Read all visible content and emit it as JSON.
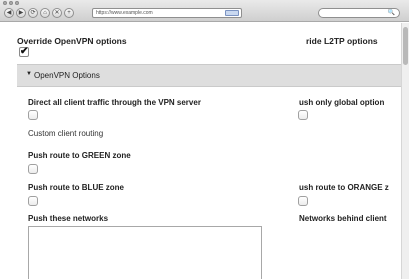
{
  "browser": {
    "nav_back": "◀",
    "nav_forward": "▶",
    "nav_reload": "⟳",
    "nav_home": "⌂",
    "nav_stop": "✕",
    "nav_bookmark": "+",
    "url": "https://www.example.com",
    "search_glyph": "🔍"
  },
  "page": {
    "override_openvpn_label": "Override OpenVPN options",
    "override_openvpn_checked": "✔",
    "override_l2tp_label": "ride L2TP options",
    "section_arrow": "▼",
    "section_title": "OpenVPN Options",
    "direct_all_label": "Direct all client traffic through the VPN server",
    "push_global_label": "ush only global option",
    "custom_routing_label": "Custom client routing",
    "push_green_label": "Push route to GREEN zone",
    "push_blue_label": "Push route to BLUE zone",
    "push_orange_label": "ush route to ORANGE z",
    "push_networks_label": "Push these networks",
    "networks_behind_label": "Networks behind client"
  }
}
